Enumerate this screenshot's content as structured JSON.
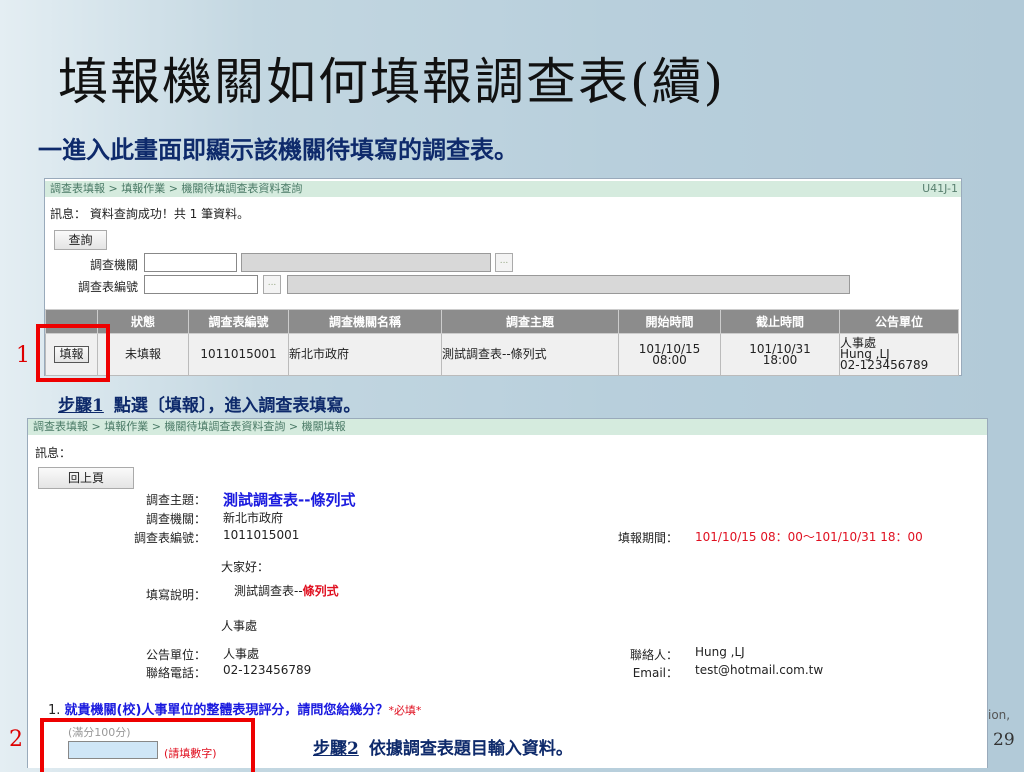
{
  "slide": {
    "title": "填報機關如何填報調查表(續)",
    "subtitle": "一進入此畫面即顯示該機關待填寫的調查表。",
    "page_number": "29",
    "footer_fragment": "ion,"
  },
  "shot1": {
    "breadcrumb": "調查表填報 > 填報作業 > 機關待填調查表資料查詢",
    "code": "U41J-1",
    "message": "訊息： 資料查詢成功！共 1 筆資料。",
    "query_button": "查詢",
    "field_agency": "調查機關",
    "field_form_no": "調查表編號",
    "dots": "...",
    "columns": [
      "",
      "狀態",
      "調查表編號",
      "調查機關名稱",
      "調查主題",
      "開始時間",
      "截止時間",
      "公告單位"
    ],
    "row": {
      "action": "填報",
      "status": "未填報",
      "form_no": "1011015001",
      "agency": "新北市政府",
      "topic": "測試調查表--條列式",
      "start_date": "101/10/15",
      "start_time": "08:00",
      "end_date": "101/10/31",
      "end_time": "18:00",
      "unit": "人事處",
      "contact": "Hung ,LJ",
      "phone": "02-123456789"
    }
  },
  "marker1": "1",
  "step1": {
    "label": "步驟1",
    "text": "點選〔填報〕，進入調查表填寫。"
  },
  "shot2": {
    "breadcrumb": "調查表填報 > 填報作業 > 機關待填調查表資料查詢 > 機關填報",
    "message": "訊息：",
    "back_button": "回上頁",
    "topic_label": "調查主題：",
    "topic": "測試調查表--條列式",
    "agency_label": "調查機關：",
    "agency": "新北市政府",
    "form_no_label": "調查表編號：",
    "form_no": "1011015001",
    "period_label": "填報期間：",
    "period": "101/10/15 08：00～101/10/31 18：00",
    "greeting": "大家好：",
    "instr_label": "填寫說明：",
    "instr_prefix": "測試調查表--",
    "instr_red": "條列式",
    "signature": "人事處",
    "unit_label": "公告單位：",
    "unit": "人事處",
    "phone_label": "聯絡電話：",
    "phone": "02-123456789",
    "contact_label": "聯絡人：",
    "contact": "Hung ,LJ",
    "email_label": "Email：",
    "email": "test@hotmail.com.tw",
    "q1_num": "1.",
    "q1": "就貴機關(校)人事單位的整體表現評分，請問您給幾分？",
    "q1_required": "*必填*",
    "q1_hint": "(滿分100分)",
    "q1_input_value": "",
    "q1_note": "(請填數字)"
  },
  "marker2": "2",
  "step2": {
    "label": "步驟2",
    "text": "依據調查表題目輸入資料。"
  }
}
